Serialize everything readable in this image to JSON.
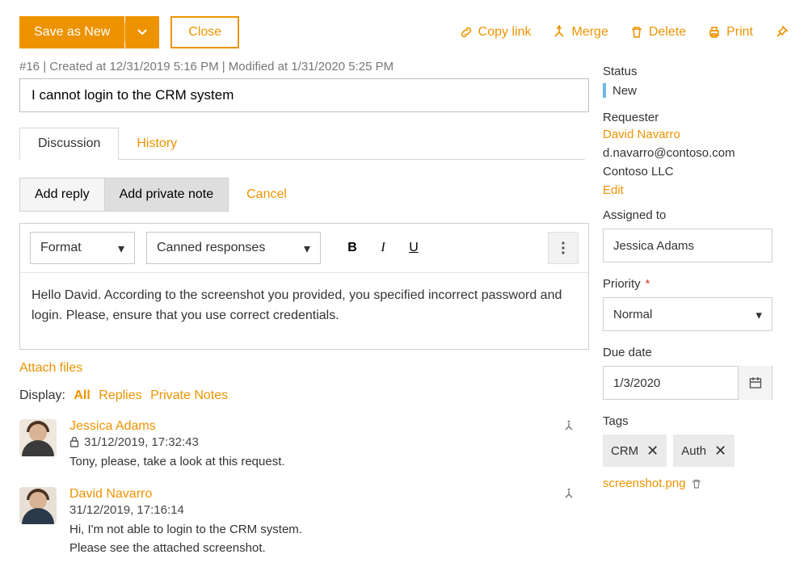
{
  "toolbar": {
    "save_label": "Save as New",
    "close_label": "Close",
    "copy_link_label": "Copy link",
    "merge_label": "Merge",
    "delete_label": "Delete",
    "print_label": "Print"
  },
  "ticket": {
    "meta_line": "#16 | Created at 12/31/2019 5:16 PM | Modified at 1/31/2020 5:25 PM",
    "title": "I cannot login to the CRM system"
  },
  "tabs": {
    "discussion": "Discussion",
    "history": "History"
  },
  "reply_bar": {
    "add_reply": "Add reply",
    "add_private": "Add private note",
    "cancel": "Cancel"
  },
  "editor": {
    "format_label": "Format",
    "canned_label": "Canned responses",
    "body": "Hello David. According to the screenshot you provided, you specified incorrect password and login. Please, ensure that you use correct credentials."
  },
  "attach_files_label": "Attach files",
  "display_filter": {
    "label": "Display:",
    "all": "All",
    "replies": "Replies",
    "private": "Private Notes"
  },
  "timeline": [
    {
      "author": "Jessica Adams",
      "private": true,
      "date": "31/12/2019, 17:32:43",
      "text": "Tony, please, take a look at this request."
    },
    {
      "author": "David Navarro",
      "private": false,
      "date": "31/12/2019, 17:16:14",
      "text": "Hi, I'm not able to login to the CRM system.\nPlease see the attached screenshot."
    }
  ],
  "side": {
    "status_label": "Status",
    "status_value": "New",
    "requester_label": "Requester",
    "requester_name": "David Navarro",
    "requester_email": "d.navarro@contoso.com",
    "requester_company": "Contoso LLC",
    "edit_label": "Edit",
    "assigned_to_label": "Assigned to",
    "assigned_to_value": "Jessica Adams",
    "priority_label": "Priority",
    "priority_value": "Normal",
    "due_date_label": "Due date",
    "due_date_value": "1/3/2020",
    "tags_label": "Tags",
    "tags": [
      "CRM",
      "Auth"
    ],
    "attachment_name": "screenshot.png"
  }
}
